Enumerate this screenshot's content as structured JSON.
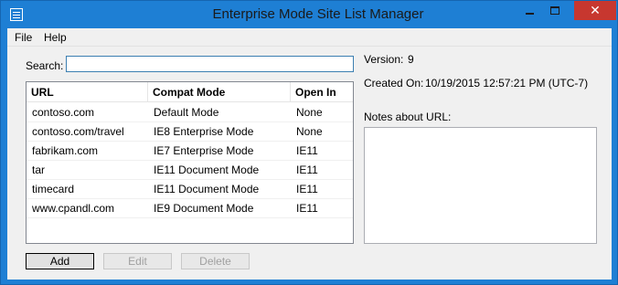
{
  "window": {
    "title": "Enterprise Mode Site List Manager",
    "close_glyph": "✕"
  },
  "menu": {
    "file": "File",
    "help": "Help"
  },
  "search": {
    "label": "Search:",
    "value": ""
  },
  "table": {
    "columns": [
      "URL",
      "Compat Mode",
      "Open In"
    ],
    "rows": [
      {
        "url": "contoso.com",
        "compat": "Default Mode",
        "open_in": "None"
      },
      {
        "url": "contoso.com/travel",
        "compat": "IE8 Enterprise Mode",
        "open_in": "None"
      },
      {
        "url": "fabrikam.com",
        "compat": "IE7 Enterprise Mode",
        "open_in": "IE11"
      },
      {
        "url": "tar",
        "compat": "IE11 Document Mode",
        "open_in": "IE11"
      },
      {
        "url": "timecard",
        "compat": "IE11 Document Mode",
        "open_in": "IE11"
      },
      {
        "url": "www.cpandl.com",
        "compat": "IE9 Document Mode",
        "open_in": "IE11"
      }
    ]
  },
  "buttons": {
    "add": "Add",
    "edit": "Edit",
    "delete": "Delete"
  },
  "info": {
    "version_label": "Version:",
    "version_value": "9",
    "created_label": "Created On:",
    "created_value": "10/19/2015 12:57:21 PM (UTC-7)",
    "notes_label": "Notes about URL:",
    "notes_value": ""
  },
  "colors": {
    "titlebar": "#1e7fd4",
    "close_button": "#c7372f",
    "client_background": "#f0f0f0"
  }
}
